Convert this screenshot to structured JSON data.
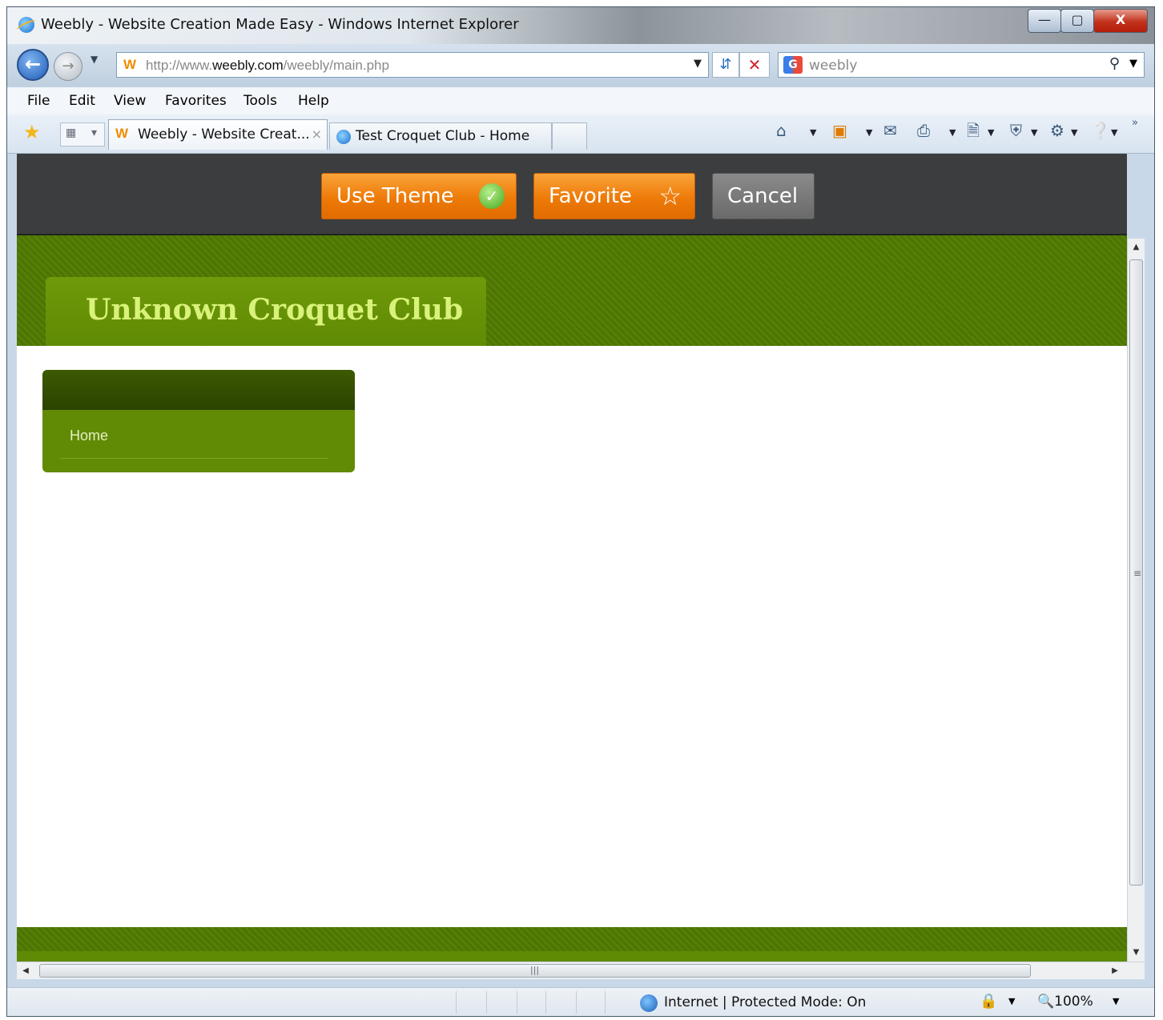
{
  "window": {
    "title": "Weebly - Website Creation Made Easy - Windows Internet Explorer",
    "min_label": "—",
    "max_label": "▢",
    "close_label": "X"
  },
  "nav": {
    "address_url_prefix": "http://www.",
    "address_url_domain": "weebly.com",
    "address_url_path": "/weebly/main.php",
    "address_favicon": "W",
    "search_provider_icon": "G",
    "search_value": "weebly"
  },
  "menu": {
    "file": "File",
    "edit": "Edit",
    "view": "View",
    "favorites": "Favorites",
    "tools": "Tools",
    "help": "Help"
  },
  "tabs": [
    {
      "favicon": "W",
      "label": "Weebly - Website Creat...",
      "close": "×"
    },
    {
      "label": "Test Croquet Club - Home"
    }
  ],
  "weebly_bar": {
    "use_theme": "Use Theme",
    "favorite": "Favorite",
    "cancel": "Cancel"
  },
  "site": {
    "title": "Unknown Croquet Club",
    "nav_items": [
      "Home"
    ]
  },
  "status": {
    "zone": "Internet | Protected Mode: On",
    "zoom": "100%"
  },
  "colors": {
    "weebly_orange": "#ee7a08",
    "site_green": "#557f06",
    "site_title": "#d9f27a"
  }
}
